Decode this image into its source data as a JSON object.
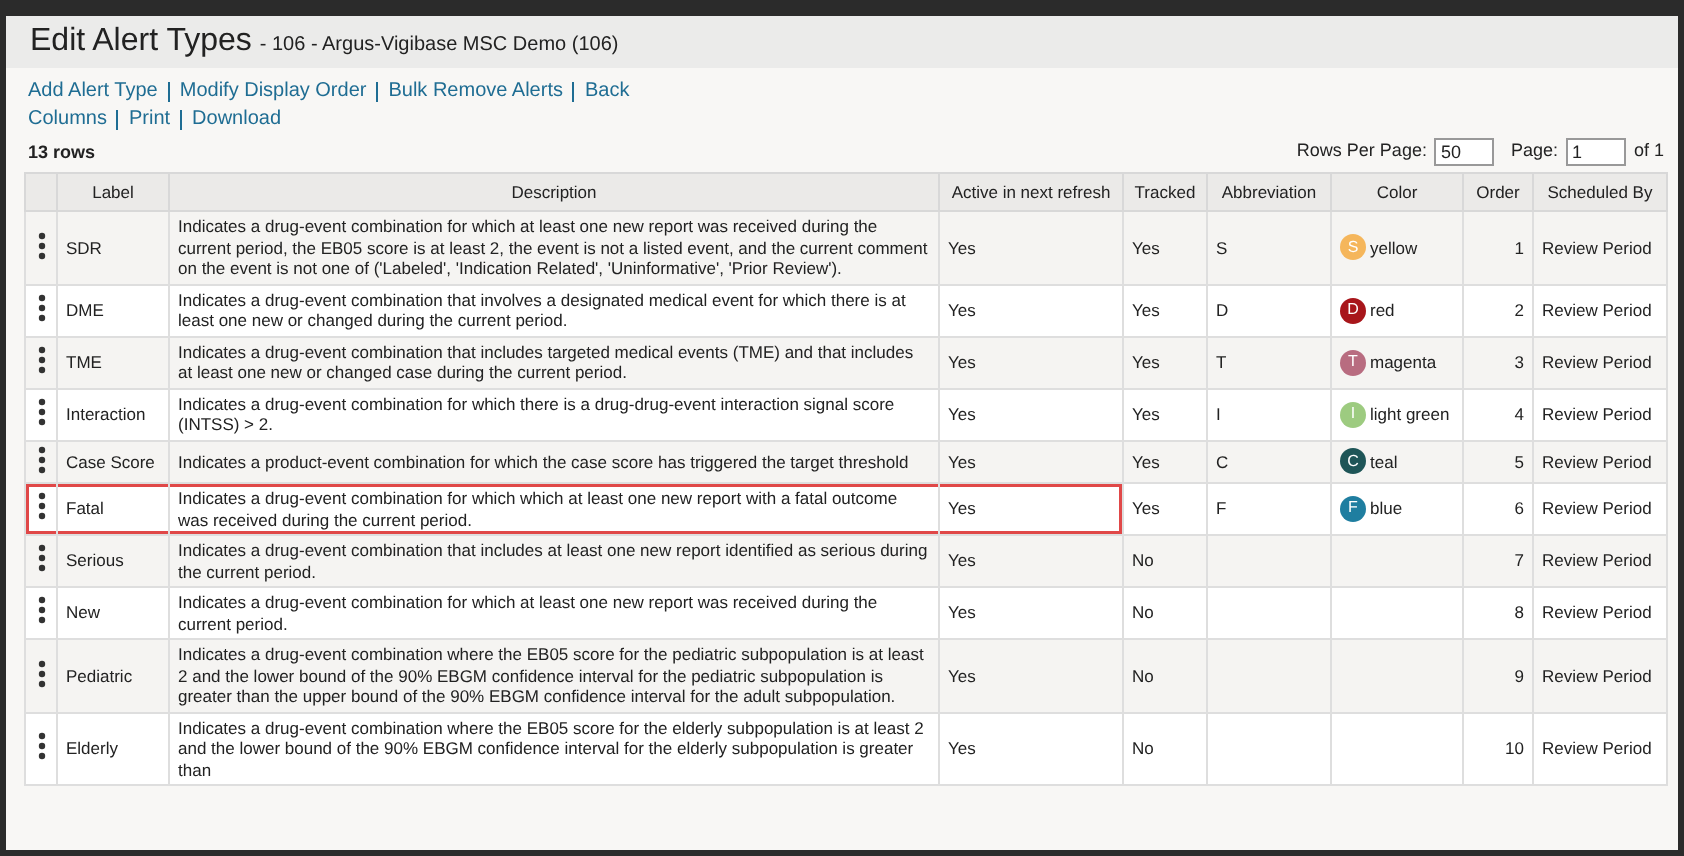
{
  "page": {
    "title": "Edit Alert Types",
    "subtitle": "- 106 - Argus-Vigibase MSC Demo (106)"
  },
  "actions": [
    [
      "Add Alert Type",
      "Modify Display Order",
      "Bulk Remove Alerts",
      "Back"
    ],
    [
      "Columns",
      "Print",
      "Download"
    ]
  ],
  "row_count": "13 rows",
  "pagination": {
    "rows_per_page_label": "Rows Per Page:",
    "rows_per_page": "50",
    "page_label": "Page:",
    "page": "1",
    "of": "of 1"
  },
  "table": {
    "columns": [
      "Label",
      "Description",
      "Active in next refresh",
      "Tracked",
      "Abbreviation",
      "Color",
      "Order",
      "Scheduled By"
    ],
    "rows": [
      {
        "label": "SDR",
        "description": "Indicates a drug-event combination for which at least one new report was received during the current period, the EB05 score is at least 2, the event is not a listed event, and the current comment on the event is not one of ('Labeled', 'Indication Related', 'Uninformative', 'Prior Review').",
        "active": "Yes",
        "tracked": "Yes",
        "abbreviation": "S",
        "badge_letter": "S",
        "color_name": "yellow",
        "color": "#f5b65b",
        "order": "1",
        "scheduled_by": "Review Period",
        "highlighted": false
      },
      {
        "label": "DME",
        "description": "Indicates a drug-event combination that involves a designated medical event for which there is at least one new or changed during the current period.",
        "active": "Yes",
        "tracked": "Yes",
        "abbreviation": "D",
        "badge_letter": "D",
        "color_name": "red",
        "color": "#a8161b",
        "order": "2",
        "scheduled_by": "Review Period",
        "highlighted": false
      },
      {
        "label": "TME",
        "description": "Indicates a drug-event combination that includes targeted medical events (TME) and that includes at least one new or changed case during the current period.",
        "active": "Yes",
        "tracked": "Yes",
        "abbreviation": "T",
        "badge_letter": "T",
        "color_name": "magenta",
        "color": "#b86c80",
        "order": "3",
        "scheduled_by": "Review Period",
        "highlighted": false
      },
      {
        "label": "Interaction",
        "description": "Indicates a drug-event combination for which there is a drug-drug-event interaction signal score (INTSS) > 2.",
        "active": "Yes",
        "tracked": "Yes",
        "abbreviation": "I",
        "badge_letter": "I",
        "color_name": "light green",
        "color": "#9dcb80",
        "order": "4",
        "scheduled_by": "Review Period",
        "highlighted": false
      },
      {
        "label": "Case Score",
        "description": "Indicates a product-event combination for which the case score has triggered the target threshold",
        "active": "Yes",
        "tracked": "Yes",
        "abbreviation": "C",
        "badge_letter": "C",
        "color_name": "teal",
        "color": "#1e5557",
        "order": "5",
        "scheduled_by": "Review Period",
        "highlighted": false
      },
      {
        "label": "Fatal",
        "description": "Indicates a drug-event combination for which which at least one new report with a fatal outcome was received during the current period.",
        "active": "Yes",
        "tracked": "Yes",
        "abbreviation": "F",
        "badge_letter": "F",
        "color_name": "blue",
        "color": "#1f7ea0",
        "order": "6",
        "scheduled_by": "Review Period",
        "highlighted": true
      },
      {
        "label": "Serious",
        "description": "Indicates a drug-event combination that includes at least one new report identified as serious during the current period.",
        "active": "Yes",
        "tracked": "No",
        "order": "7",
        "scheduled_by": "Review Period",
        "highlighted": false
      },
      {
        "label": "New",
        "description": "Indicates a drug-event combination for which at least one new report was received during the current period.",
        "active": "Yes",
        "tracked": "No",
        "order": "8",
        "scheduled_by": "Review Period",
        "highlighted": false
      },
      {
        "label": "Pediatric",
        "description": "Indicates a drug-event combination where the EB05 score for the pediatric subpopulation is at least 2 and the lower bound of the 90% EBGM confidence interval for the pediatric subpopulation is greater than the upper bound of the 90% EBGM confidence interval for the adult subpopulation.",
        "active": "Yes",
        "tracked": "No",
        "order": "9",
        "scheduled_by": "Review Period",
        "highlighted": false
      },
      {
        "label": "Elderly",
        "description": "Indicates a drug-event combination where the EB05 score for the elderly subpopulation is at least 2 and the lower bound of the 90% EBGM confidence interval for the elderly subpopulation is greater than",
        "active": "Yes",
        "tracked": "No",
        "order": "10",
        "scheduled_by": "Review Period",
        "highlighted": false
      }
    ]
  }
}
